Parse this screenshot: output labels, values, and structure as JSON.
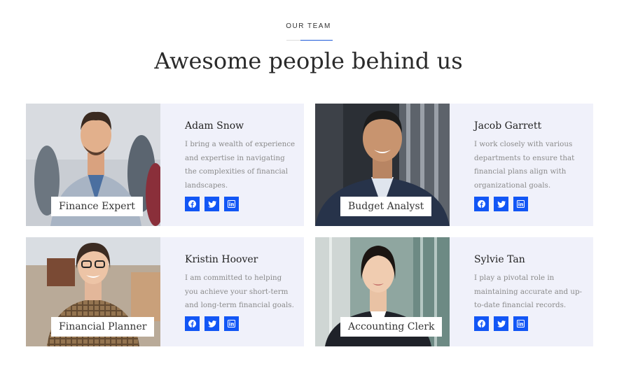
{
  "section": {
    "eyebrow": "OUR TEAM",
    "title": "Awesome people behind us"
  },
  "colors": {
    "accent": "#1256f5",
    "card_bg": "#f0f1fa",
    "divider_accent": "#1f5bd8"
  },
  "team": [
    {
      "name": "Adam Snow",
      "role": "Finance Expert",
      "bio": "I bring a wealth of experience and expertise in navigating the complexities of financial landscapes.",
      "socials": [
        "facebook-icon",
        "twitter-icon",
        "linkedin-icon"
      ]
    },
    {
      "name": "Jacob Garrett",
      "role": "Budget Analyst",
      "bio": "I work closely with various departments to ensure that financial plans align with organizational goals.",
      "socials": [
        "facebook-icon",
        "twitter-icon",
        "linkedin-icon"
      ]
    },
    {
      "name": "Kristin Hoover",
      "role": "Financial Planner",
      "bio": "I am committed to helping you achieve your short-term and long-term financial goals.",
      "socials": [
        "facebook-icon",
        "twitter-icon",
        "linkedin-icon"
      ]
    },
    {
      "name": "Sylvie Tan",
      "role": "Accounting Clerk",
      "bio": "I play a pivotal role in maintaining accurate and up-to-date financial records.",
      "socials": [
        "facebook-icon",
        "twitter-icon",
        "linkedin-icon"
      ]
    }
  ]
}
